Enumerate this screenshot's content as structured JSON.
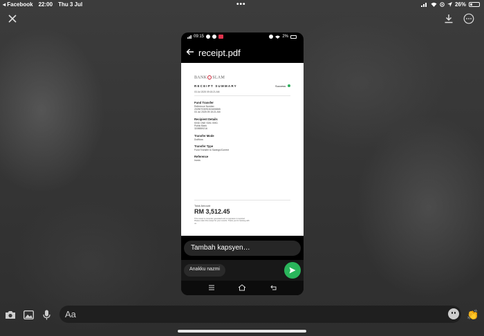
{
  "status_bar": {
    "back_app": "◂ Facebook",
    "time": "22:00",
    "date": "Thu 3 Jul",
    "center_dots": "•••",
    "battery": "26%"
  },
  "viewer": {
    "close_icon": "close-icon",
    "download_icon": "download-icon",
    "more_icon": "more-options-icon"
  },
  "phone": {
    "status_time": "09:15",
    "status_battery": "2%",
    "pdf_title": "receipt.pdf",
    "receipt": {
      "bank_logo_prefix": "BANK",
      "bank_logo_suffix": "SLAM",
      "title": "RECEIPT SUMMARY",
      "status": "Success",
      "date": "03 Jul 2025 09:15:21 AM",
      "sections": [
        {
          "heading": "Fund Transfer",
          "lines": [
            "Reference Number:",
            "20250703091521606865",
            "03 Jul 2025 09:15:21 AM"
          ]
        },
        {
          "heading": "Recipient Details",
          "lines": [
            "KIND ONE SDN. BHD.",
            "Public Bank",
            "3208559216"
          ]
        },
        {
          "heading": "Transfer Mode",
          "lines": [
            "DuitNow"
          ]
        },
        {
          "heading": "Transfer Type",
          "lines": [
            "Fund Transfer to Savings/Current"
          ]
        },
        {
          "heading": "Reference",
          "lines": [
            "Invois"
          ]
        }
      ],
      "amount_label": "Total Amount",
      "amount": "RM 3,512.45",
      "disclaimer": "This receipt is computer generated and no signature is required. Please retain this receipt for your records. Thank you for banking with us."
    },
    "caption_placeholder": "Tambah kapsyen…",
    "recipient": "Anakku nazmi"
  },
  "composer": {
    "placeholder": "Aa"
  },
  "colors": {
    "send_green": "#2ab55b",
    "success_green": "#2eae5c",
    "bank_red": "#cc2233"
  }
}
